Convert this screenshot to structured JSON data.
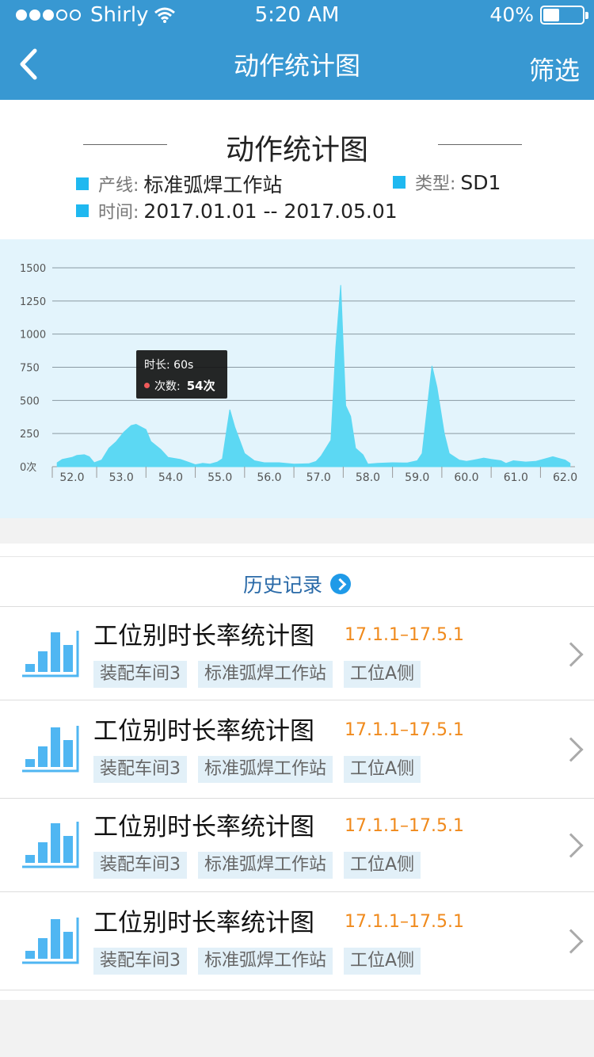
{
  "status": {
    "carrier": "Shirly",
    "time": "5:20 AM",
    "battery": "40%"
  },
  "nav": {
    "title": "动作统计图",
    "filter": "筛选"
  },
  "card": {
    "heading": "动作统计图",
    "line_label": "产线:",
    "line_value": "标准弧焊工作站",
    "type_label": "类型:",
    "type_value": "SD1",
    "time_label": "时间:",
    "time_value": "2017.01.01 -- 2017.05.01"
  },
  "tooltip": {
    "duration_label": "时长:",
    "duration": "60s",
    "count_label": "次数:",
    "count": "54次"
  },
  "chart_data": {
    "type": "area",
    "ylim": [
      0,
      1500
    ],
    "y_ticks": [
      "0次",
      "250",
      "500",
      "750",
      "1000",
      "1250",
      "1500"
    ],
    "x_ticks": [
      "52.0",
      "53.0",
      "54.0",
      "55.0",
      "56.0",
      "57.0",
      "58.0",
      "59.0",
      "60.0",
      "61.0",
      "62.0"
    ],
    "xlim": [
      51.6,
      62.2
    ],
    "color": "#5cd8f3",
    "points": [
      [
        51.7,
        30
      ],
      [
        51.8,
        55
      ],
      [
        52.0,
        70
      ],
      [
        52.1,
        85
      ],
      [
        52.25,
        90
      ],
      [
        52.35,
        75
      ],
      [
        52.45,
        30
      ],
      [
        52.6,
        50
      ],
      [
        52.75,
        140
      ],
      [
        52.9,
        190
      ],
      [
        53.05,
        260
      ],
      [
        53.2,
        310
      ],
      [
        53.3,
        320
      ],
      [
        53.5,
        280
      ],
      [
        53.6,
        190
      ],
      [
        53.8,
        130
      ],
      [
        53.95,
        70
      ],
      [
        54.2,
        55
      ],
      [
        54.35,
        35
      ],
      [
        54.5,
        15
      ],
      [
        54.65,
        25
      ],
      [
        54.8,
        20
      ],
      [
        54.95,
        35
      ],
      [
        55.05,
        60
      ],
      [
        55.2,
        430
      ],
      [
        55.3,
        300
      ],
      [
        55.5,
        100
      ],
      [
        55.7,
        45
      ],
      [
        55.9,
        30
      ],
      [
        56.2,
        30
      ],
      [
        56.5,
        20
      ],
      [
        56.8,
        22
      ],
      [
        56.95,
        40
      ],
      [
        57.05,
        80
      ],
      [
        57.25,
        200
      ],
      [
        57.35,
        900
      ],
      [
        57.45,
        1370
      ],
      [
        57.55,
        460
      ],
      [
        57.65,
        380
      ],
      [
        57.75,
        140
      ],
      [
        57.9,
        90
      ],
      [
        58.0,
        20
      ],
      [
        58.2,
        25
      ],
      [
        58.5,
        30
      ],
      [
        58.8,
        28
      ],
      [
        59.0,
        45
      ],
      [
        59.1,
        100
      ],
      [
        59.3,
        760
      ],
      [
        59.4,
        600
      ],
      [
        59.55,
        250
      ],
      [
        59.65,
        100
      ],
      [
        59.85,
        50
      ],
      [
        60.0,
        40
      ],
      [
        60.15,
        50
      ],
      [
        60.35,
        65
      ],
      [
        60.5,
        55
      ],
      [
        60.7,
        45
      ],
      [
        60.8,
        25
      ],
      [
        60.95,
        45
      ],
      [
        61.2,
        35
      ],
      [
        61.4,
        40
      ],
      [
        61.6,
        60
      ],
      [
        61.75,
        75
      ],
      [
        61.9,
        60
      ],
      [
        62.0,
        50
      ],
      [
        62.1,
        25
      ]
    ]
  },
  "history": {
    "title": "历史记录",
    "items": [
      {
        "name": "工位别时长率统计图",
        "date": "17.1.1–17.5.1",
        "tags": [
          "装配车间3",
          "标准弧焊工作站",
          "工位A侧"
        ]
      },
      {
        "name": "工位别时长率统计图",
        "date": "17.1.1–17.5.1",
        "tags": [
          "装配车间3",
          "标准弧焊工作站",
          "工位A侧"
        ]
      },
      {
        "name": "工位别时长率统计图",
        "date": "17.1.1–17.5.1",
        "tags": [
          "装配车间3",
          "标准弧焊工作站",
          "工位A侧"
        ]
      },
      {
        "name": "工位别时长率统计图",
        "date": "17.1.1–17.5.1",
        "tags": [
          "装配车间3",
          "标准弧焊工作站",
          "工位A侧"
        ]
      }
    ]
  }
}
